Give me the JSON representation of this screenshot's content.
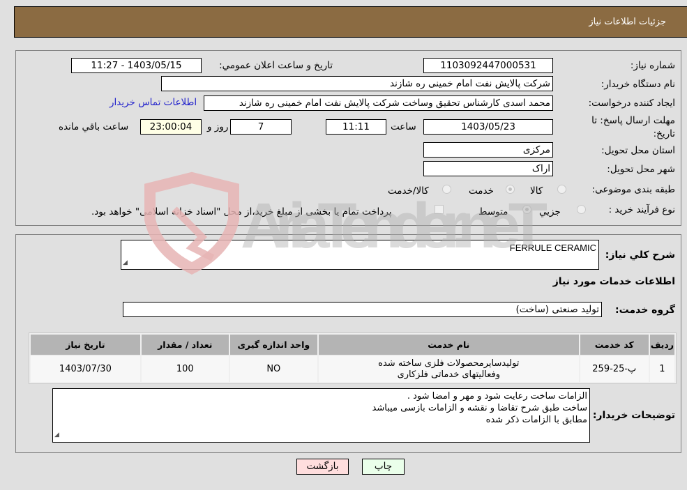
{
  "header": {
    "title": "جزئیات اطلاعات نیاز"
  },
  "form": {
    "need_number": {
      "label": "شماره نیاز:",
      "value": "1103092447000531"
    },
    "announce_datetime": {
      "label": "تاریخ و ساعت اعلان عمومي:",
      "value": "1403/05/15 - 11:27"
    },
    "buyer_org": {
      "label": "نام دستگاه خريدار:",
      "value": "شرکت پالايش نفت امام خمينی  ره  شازند"
    },
    "requester": {
      "label": "ايجاد کننده درخواست:",
      "value": "محمد اسدی کارشناس تحقيق وساخت شرکت پالايش نفت امام خمينی  ره  شازند"
    },
    "buyer_contact_link": "اطلاعات تماس خريدار",
    "deadline": {
      "label": "مهلت ارسال پاسخ: تا تاريخ:",
      "date": "1403/05/23",
      "time_label": "ساعت",
      "time": "11:11",
      "days": "7",
      "days_label": "روز و",
      "remaining": "23:00:04",
      "remaining_label": "ساعت باقي مانده"
    },
    "province": {
      "label": "استان محل تحويل:",
      "value": "مرکزی"
    },
    "city": {
      "label": "شهر محل تحويل:",
      "value": "اراک"
    },
    "category": {
      "label": "طبقه بندی موضوعی:",
      "options": [
        "کالا",
        "خدمت",
        "کالا/خدمت"
      ],
      "selected": "خدمت"
    },
    "purchase_type": {
      "label": "نوع فرآيند خريد :",
      "options": [
        "جزيي",
        "متوسط"
      ],
      "selected": "متوسط",
      "treasury_note": "پرداخت تمام يا بخشی از مبلغ خريد،از محل \"اسناد خزانه اسلامی\" خواهد بود."
    }
  },
  "details": {
    "general_desc": {
      "label": "شرح کلي نياز:",
      "value": "FERRULE CERAMIC"
    },
    "services_heading": "اطلاعات خدمات مورد نياز",
    "service_group": {
      "label": "گروه خدمت:",
      "value": "توليد صنعتی (ساخت)"
    },
    "table": {
      "headers": [
        "رديف",
        "کد خدمت",
        "نام خدمت",
        "واحد اندازه گيری",
        "تعداد / مقدار",
        "تاريخ نياز"
      ],
      "rows": [
        [
          "1",
          "پ-25-259",
          "توليدسايرمحصولات فلزی ساخته شده وفعاليتهای خدماتی فلزکاری",
          "NO",
          "100",
          "1403/07/30"
        ]
      ]
    },
    "buyer_notes": {
      "label": "توضيحات خريدار:",
      "lines": [
        "الزامات ساخت رعايت شود و مهر و امضا شود .",
        "ساخت طبق شرح تقاضا و نقشه و الزامات بازسی ميباشد",
        "مطابق با الزامات ذکر شده"
      ]
    }
  },
  "buttons": {
    "print": "چاپ",
    "back": "بازگشت"
  },
  "colors": {
    "header_bg": "#8b6b42",
    "link": "#2222cc",
    "back_btn": "#ffdede",
    "print_btn": "#eaffea"
  },
  "watermark": "AriaTender.neT"
}
